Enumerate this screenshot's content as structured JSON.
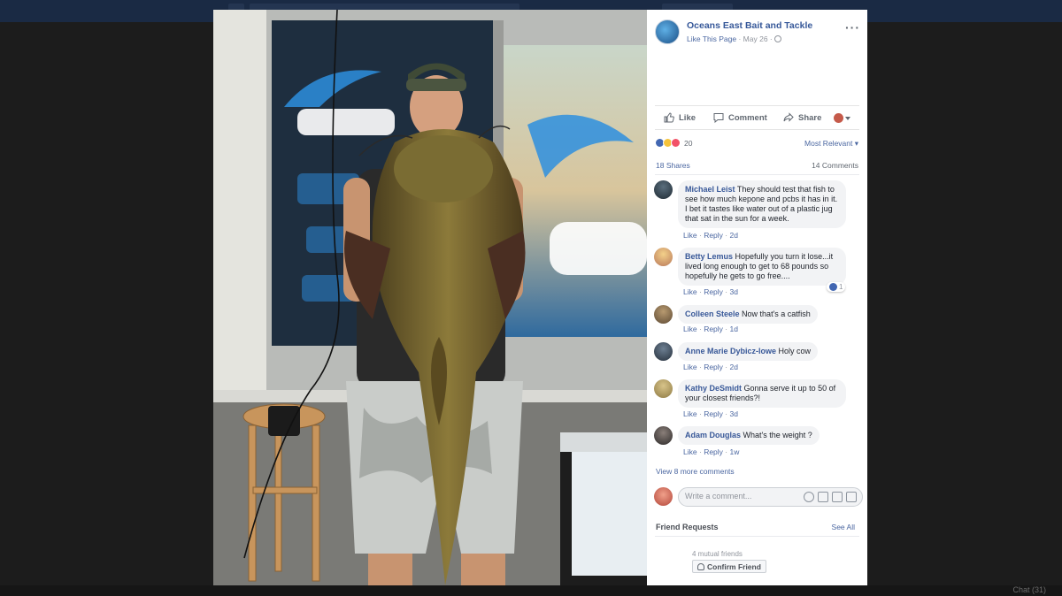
{
  "post": {
    "page_name": "Oceans East Bait and Tackle",
    "like_page": "Like This Page",
    "separator": "·",
    "date": "May 26",
    "privacy_icon": "globe-icon",
    "more_label": "···"
  },
  "actions": {
    "like": "Like",
    "comment": "Comment",
    "share": "Share"
  },
  "reactions": {
    "count": "20",
    "sort": "Most Relevant ▾",
    "colors": {
      "like": "#4267b2",
      "wow": "#f5c33b",
      "love": "#f25268"
    }
  },
  "stats": {
    "shares": "18 Shares",
    "comments": "14 Comments"
  },
  "comments": [
    {
      "name": "Michael Leist",
      "text": "They should test that fish to see how much kepone and pcbs it has in it. I bet it tastes like water out of a plastic jug that sat in the sun for a week.",
      "like": "Like",
      "reply": "Reply",
      "time": "2d"
    },
    {
      "name": "Betty Lemus",
      "text": "Hopefully you turn it lose...it lived long enough to get to 68 pounds so hopefully he gets to go free....",
      "like": "Like",
      "reply": "Reply",
      "time": "3d",
      "likes": "1"
    },
    {
      "name": "Colleen Steele",
      "text": "Now that's a catfish",
      "like": "Like",
      "reply": "Reply",
      "time": "1d"
    },
    {
      "name": "Anne Marie Dybicz-lowe",
      "text": "Holy cow",
      "like": "Like",
      "reply": "Reply",
      "time": "2d"
    },
    {
      "name": "Kathy DeSmidt",
      "text": "Gonna serve it up to 50 of your closest friends?!",
      "like": "Like",
      "reply": "Reply",
      "time": "3d"
    },
    {
      "name": "Adam Douglas",
      "text": "What's the weight ?",
      "like": "Like",
      "reply": "Reply",
      "time": "1w"
    }
  ],
  "view_more": "View 8 more comments",
  "write_placeholder": "Write a comment...",
  "friend_requests": {
    "title": "Friend Requests",
    "see_all": "See All",
    "mutual": "4 mutual friends",
    "confirm": "Confirm Friend"
  },
  "chat": "Chat (31)"
}
